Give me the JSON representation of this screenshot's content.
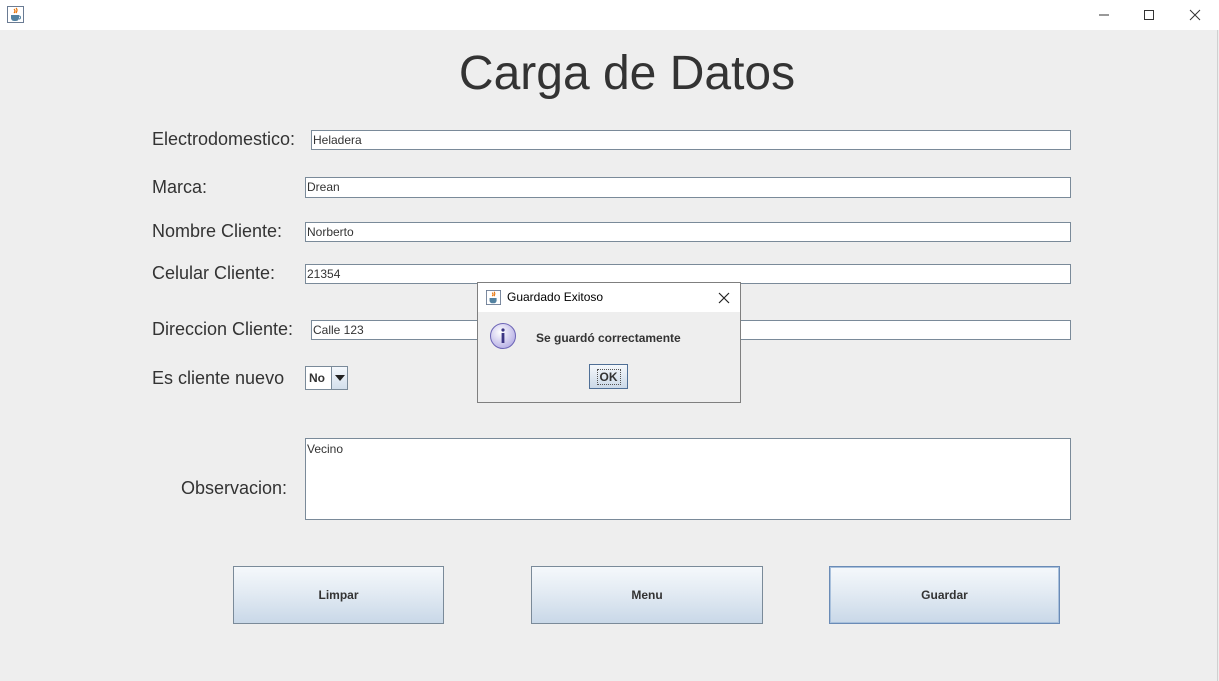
{
  "window": {
    "icon": "java-coffee-icon",
    "controls": [
      "minimize-icon",
      "maximize-icon",
      "close-icon"
    ]
  },
  "form": {
    "title": "Carga de Datos",
    "electrodomestico": {
      "label": "Electrodomestico:",
      "value": "Heladera"
    },
    "marca": {
      "label": "Marca:",
      "value": "Drean"
    },
    "nombre_cliente": {
      "label": "Nombre Cliente:",
      "value": "Norberto"
    },
    "celular_cliente": {
      "label": "Celular Cliente:",
      "value": "21354"
    },
    "direccion_cliente": {
      "label": "Direccion Cliente:",
      "value": "Calle 123"
    },
    "es_cliente_nuevo": {
      "label": "Es cliente nuevo",
      "value": "No"
    },
    "observacion": {
      "label": "Observacion:",
      "value": "Vecino"
    }
  },
  "buttons": {
    "limpiar": "Limpar",
    "menu": "Menu",
    "guardar": "Guardar"
  },
  "dialog": {
    "title": "Guardado Exitoso",
    "message": "Se guardó correctamente",
    "ok_label": "OK",
    "icon": "info-icon"
  }
}
